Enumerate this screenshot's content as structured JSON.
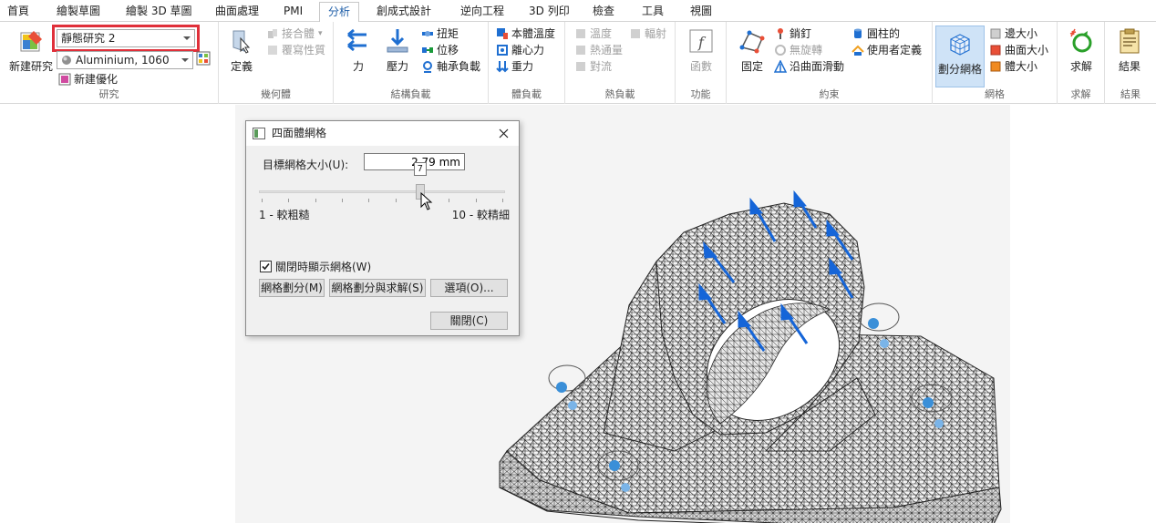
{
  "tabs": [
    "首頁",
    "繪製草圖",
    "繪製 3D 草圖",
    "曲面處理",
    "PMI",
    "分析",
    "創成式設計",
    "逆向工程",
    "3D 列印",
    "檢查",
    "工具",
    "視圖"
  ],
  "active_tab": "分析",
  "ribbon": {
    "study": {
      "new_study": "新建研究",
      "study_select": "靜態研究 2",
      "material_select": "Aluminium, 1060",
      "new_optimization": "新建優化",
      "label": "研究"
    },
    "geometry": {
      "define": "定義",
      "contact": "接合體",
      "override": "覆寫性質",
      "label": "幾何體"
    },
    "structural": {
      "force": "力",
      "pressure": "壓力",
      "torque": "扭矩",
      "displacement": "位移",
      "bearing": "軸承負載",
      "label": "結構負載"
    },
    "body": {
      "temperature": "本體溫度",
      "centrifugal": "離心力",
      "gravity": "重力",
      "label": "體負載"
    },
    "thermal": {
      "temp": "溫度",
      "heat_flux": "熱通量",
      "convection": "對流",
      "radiation": "輻射",
      "label": "熱負載"
    },
    "function": {
      "func": "函數",
      "label": "功能"
    },
    "constraints": {
      "fixed": "固定",
      "pin": "銷釘",
      "no_rotation": "無旋轉",
      "slide": "沿曲面滑動",
      "cylindrical": "圓柱的",
      "user_defined": "使用者定義",
      "label": "約束"
    },
    "mesh": {
      "generate": "劃分網格",
      "edge_size": "邊大小",
      "surface_size": "曲面大小",
      "volume_size": "體大小",
      "label": "網格"
    },
    "solve": {
      "solve": "求解",
      "label": "求解"
    },
    "results": {
      "results": "結果",
      "label": "結果"
    }
  },
  "dialog": {
    "title": "四面體網格",
    "target_label": "目標網格大小(U):",
    "target_value": "2.79 mm",
    "slider_value": "7",
    "slider_fraction": 0.655,
    "min_label": "1 - 較粗糙",
    "max_label": "10 - 較精細",
    "show_mesh_label": "關閉時顯示網格(W)",
    "show_mesh_checked": true,
    "btn_mesh": "網格劃分(M)",
    "btn_mesh_solve": "網格劃分與求解(S)",
    "btn_options": "選項(O)...",
    "btn_close": "關閉(C)"
  },
  "colors": {
    "accent": "#1f5fa8",
    "highlight": "#e0303a",
    "arrow": "#1565d8",
    "fixture": "#3a8fd8"
  }
}
